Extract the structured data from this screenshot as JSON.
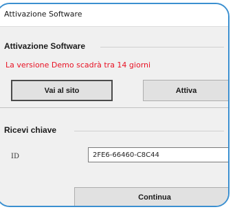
{
  "window": {
    "title": "Attivazione Software"
  },
  "activation_group": {
    "title": "Attivazione Software",
    "demo_notice": "La versione Demo scadrà tra 14 giorni",
    "visit_site_button": "Vai al sito",
    "activate_button": "Attiva"
  },
  "key_group": {
    "title": "Ricevi chiave",
    "id_label": "ID",
    "id_value": "2FE6-66460-C8C44"
  },
  "continue_button": "Continua",
  "colors": {
    "frame_accent": "#3a8fd0",
    "notice_text": "#e81123"
  }
}
